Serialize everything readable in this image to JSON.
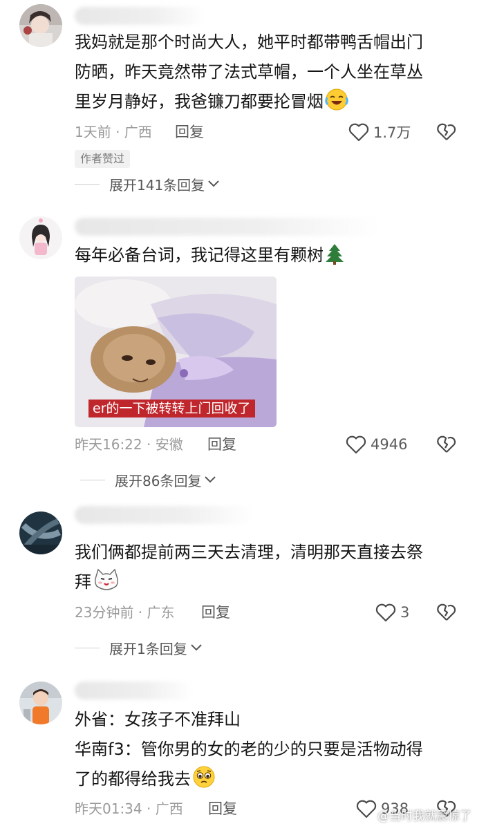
{
  "comments": [
    {
      "lines": [
        "我妈就是那个时尚大人，她平时都带鸭舌帽出门",
        "防晒，昨天竟然带了法式草帽，一个人坐在草丛",
        "里岁月静好，我爸镰刀都要抡冒烟"
      ],
      "emoji": "laughing-crying-emoji",
      "time": "1天前 · 广西",
      "reply": "回复",
      "likes": "1.7万",
      "badge": "作者赞过",
      "expand": "展开141条回复"
    },
    {
      "lines": [
        "每年必备台词，我记得这里有颗树"
      ],
      "emoji": "tree-emoji",
      "image_caption": "er的一下被转转上门回收了",
      "time": "昨天16:22 · 安徽",
      "reply": "回复",
      "likes": "4946",
      "expand": "展开86条回复"
    },
    {
      "lines": [
        "我们俩都提前两三天去清理，清明那天直接去祭",
        "拜"
      ],
      "emoji": "cat-face-emoji",
      "time": "23分钟前 · 广东",
      "reply": "回复",
      "likes": "3",
      "expand": "展开1条回复"
    },
    {
      "lines": [
        "外省：女孩子不准拜山",
        "华南f3：管你男的女的老的少的只要是活物动得",
        "了的都得给我去"
      ],
      "emoji": "pleading-face-emoji",
      "time": "昨天01:34 · 广西",
      "reply": "回复",
      "likes": "938"
    }
  ],
  "watermark": "@当时我就震惊了",
  "colors": {
    "caption_bg": "#c0272d",
    "meta": "#9a9a9a"
  }
}
